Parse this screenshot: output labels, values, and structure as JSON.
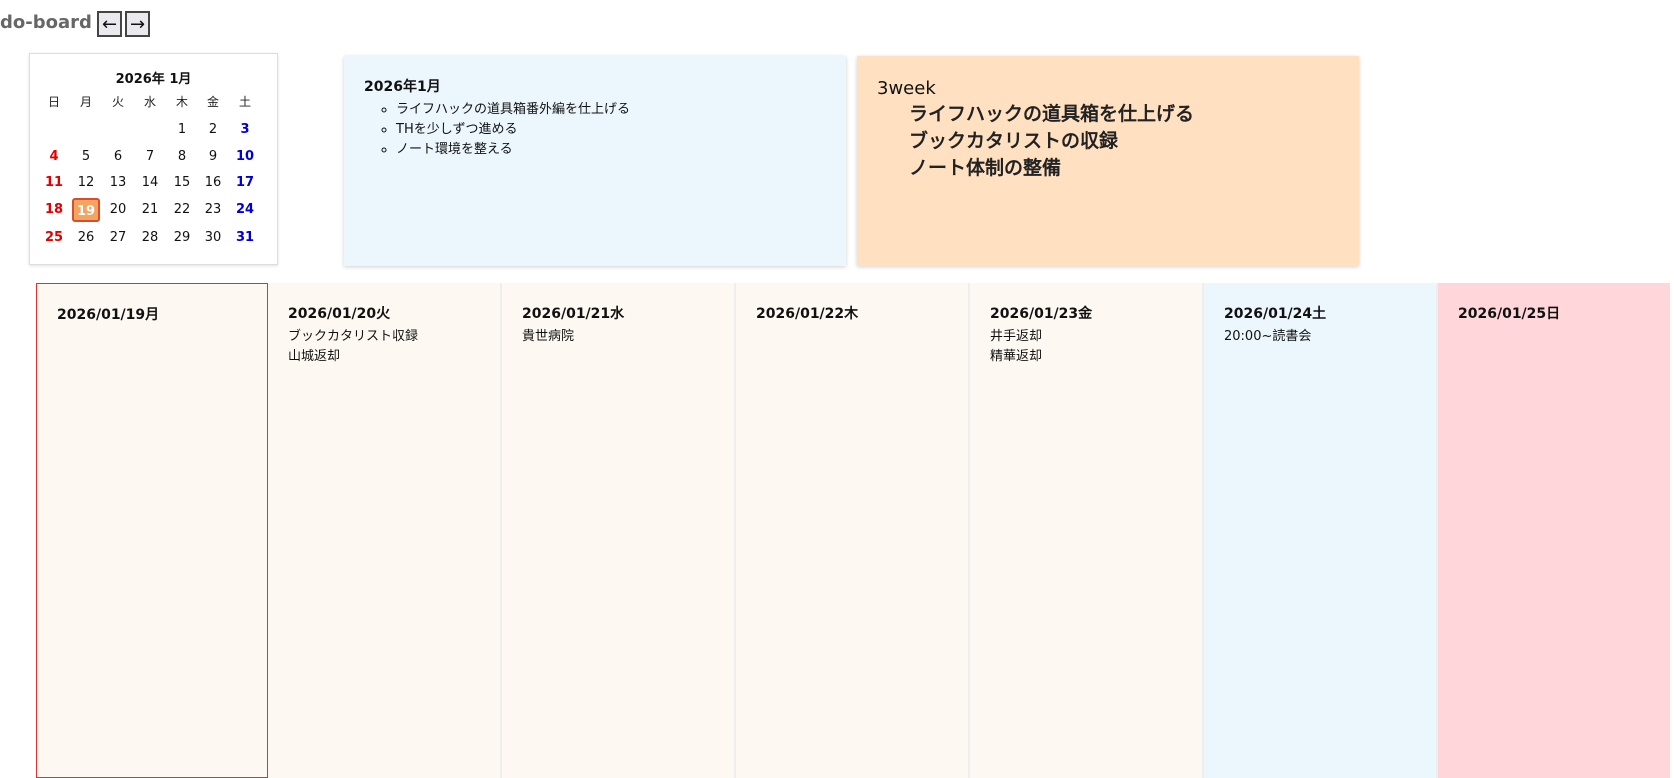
{
  "app": {
    "title": "do-board"
  },
  "nav": {
    "prev_label": "←",
    "next_label": "→"
  },
  "mini_calendar": {
    "title": "2026年 1月",
    "weekdays": [
      "日",
      "月",
      "火",
      "水",
      "木",
      "金",
      "土"
    ],
    "weeks": [
      [
        "",
        "",
        "",
        "",
        "1",
        "2",
        "3"
      ],
      [
        "4",
        "5",
        "6",
        "7",
        "8",
        "9",
        "10"
      ],
      [
        "11",
        "12",
        "13",
        "14",
        "15",
        "16",
        "17"
      ],
      [
        "18",
        "19",
        "20",
        "21",
        "22",
        "23",
        "24"
      ],
      [
        "25",
        "26",
        "27",
        "28",
        "29",
        "30",
        "31"
      ]
    ],
    "today": "19",
    "colors": {
      "sunday": "#e00000",
      "saturday": "#0000d0",
      "today_bg": "#f4a460",
      "today_border": "#d84d2b"
    }
  },
  "month_card": {
    "title": "2026年1月",
    "items": [
      "ライフハックの道具箱番外編を仕上げる",
      "THを少しずつ進める",
      "ノート環境を整える"
    ],
    "bg": "#ebf6fd"
  },
  "week_card": {
    "title": "3week",
    "goals": [
      "ライフハックの道具箱を仕上げる",
      "ブックカタリストの収録",
      "ノート体制の整備"
    ],
    "bg": "#ffe1c2"
  },
  "days": [
    {
      "date": "2026/01/19月",
      "items": [],
      "kind": "today"
    },
    {
      "date": "2026/01/20火",
      "items": [
        "ブックカタリスト収録",
        "山城返却"
      ],
      "kind": "normal"
    },
    {
      "date": "2026/01/21水",
      "items": [
        "貴世病院"
      ],
      "kind": "normal"
    },
    {
      "date": "2026/01/22木",
      "items": [],
      "kind": "normal"
    },
    {
      "date": "2026/01/23金",
      "items": [
        "井手返却",
        "精華返却"
      ],
      "kind": "normal"
    },
    {
      "date": "2026/01/24土",
      "items": [
        "20:00~読書会"
      ],
      "kind": "saturday"
    },
    {
      "date": "2026/01/25日",
      "items": [],
      "kind": "sunday"
    }
  ]
}
